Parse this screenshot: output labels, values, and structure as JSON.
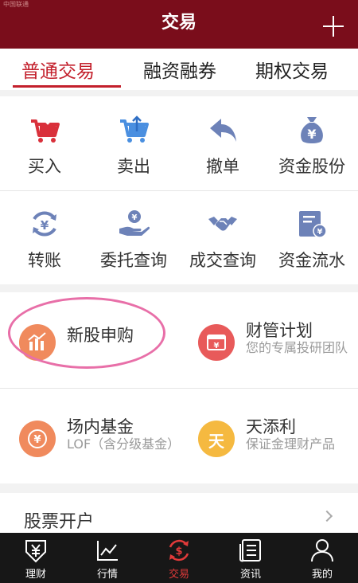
{
  "status_bar": {
    "text": "中国联通"
  },
  "header": {
    "title": "交易"
  },
  "tabs": [
    {
      "label": "普通交易",
      "active": true
    },
    {
      "label": "融资融券",
      "active": false
    },
    {
      "label": "期权交易",
      "active": false
    }
  ],
  "grid": [
    {
      "label": "买入",
      "icon": "cart-down-icon"
    },
    {
      "label": "卖出",
      "icon": "cart-up-icon"
    },
    {
      "label": "撤单",
      "icon": "undo-arrow-icon"
    },
    {
      "label": "资金股份",
      "icon": "money-bag-icon"
    },
    {
      "label": "转账",
      "icon": "yen-transfer-icon"
    },
    {
      "label": "委托查询",
      "icon": "hand-coin-icon"
    },
    {
      "label": "成交查询",
      "icon": "handshake-icon"
    },
    {
      "label": "资金流水",
      "icon": "bill-icon"
    }
  ],
  "features": [
    {
      "title": "新股申购",
      "desc": "",
      "icon": "ipo-chart-icon",
      "color": "#f08a5d",
      "glyph": ""
    },
    {
      "title": "财管计划",
      "desc": "您的专属投研团队",
      "icon": "wallet-icon",
      "color": "#e85a5a",
      "glyph": "¥"
    },
    {
      "title": "场内基金",
      "desc": "LOF（含分级基金）",
      "icon": "fund-yen-icon",
      "color": "#f08a5d",
      "glyph": "¥"
    },
    {
      "title": "天添利",
      "desc": "保证金理财产品",
      "icon": "tian-icon",
      "color": "#f5b940",
      "glyph": "天"
    }
  ],
  "open_account": {
    "label": "股票开户"
  },
  "bottom_nav": [
    {
      "label": "理财",
      "icon": "yen-box-icon",
      "active": false
    },
    {
      "label": "行情",
      "icon": "line-chart-icon",
      "active": false
    },
    {
      "label": "交易",
      "icon": "dollar-cycle-icon",
      "active": true
    },
    {
      "label": "资讯",
      "icon": "news-icon",
      "active": false
    },
    {
      "label": "我的",
      "icon": "person-icon",
      "active": false
    }
  ],
  "colors": {
    "header_bg": "#7a0d1b",
    "accent": "#c3202c",
    "icon_blue": "#5b6fa8",
    "highlight_ring": "#e86fa8"
  }
}
